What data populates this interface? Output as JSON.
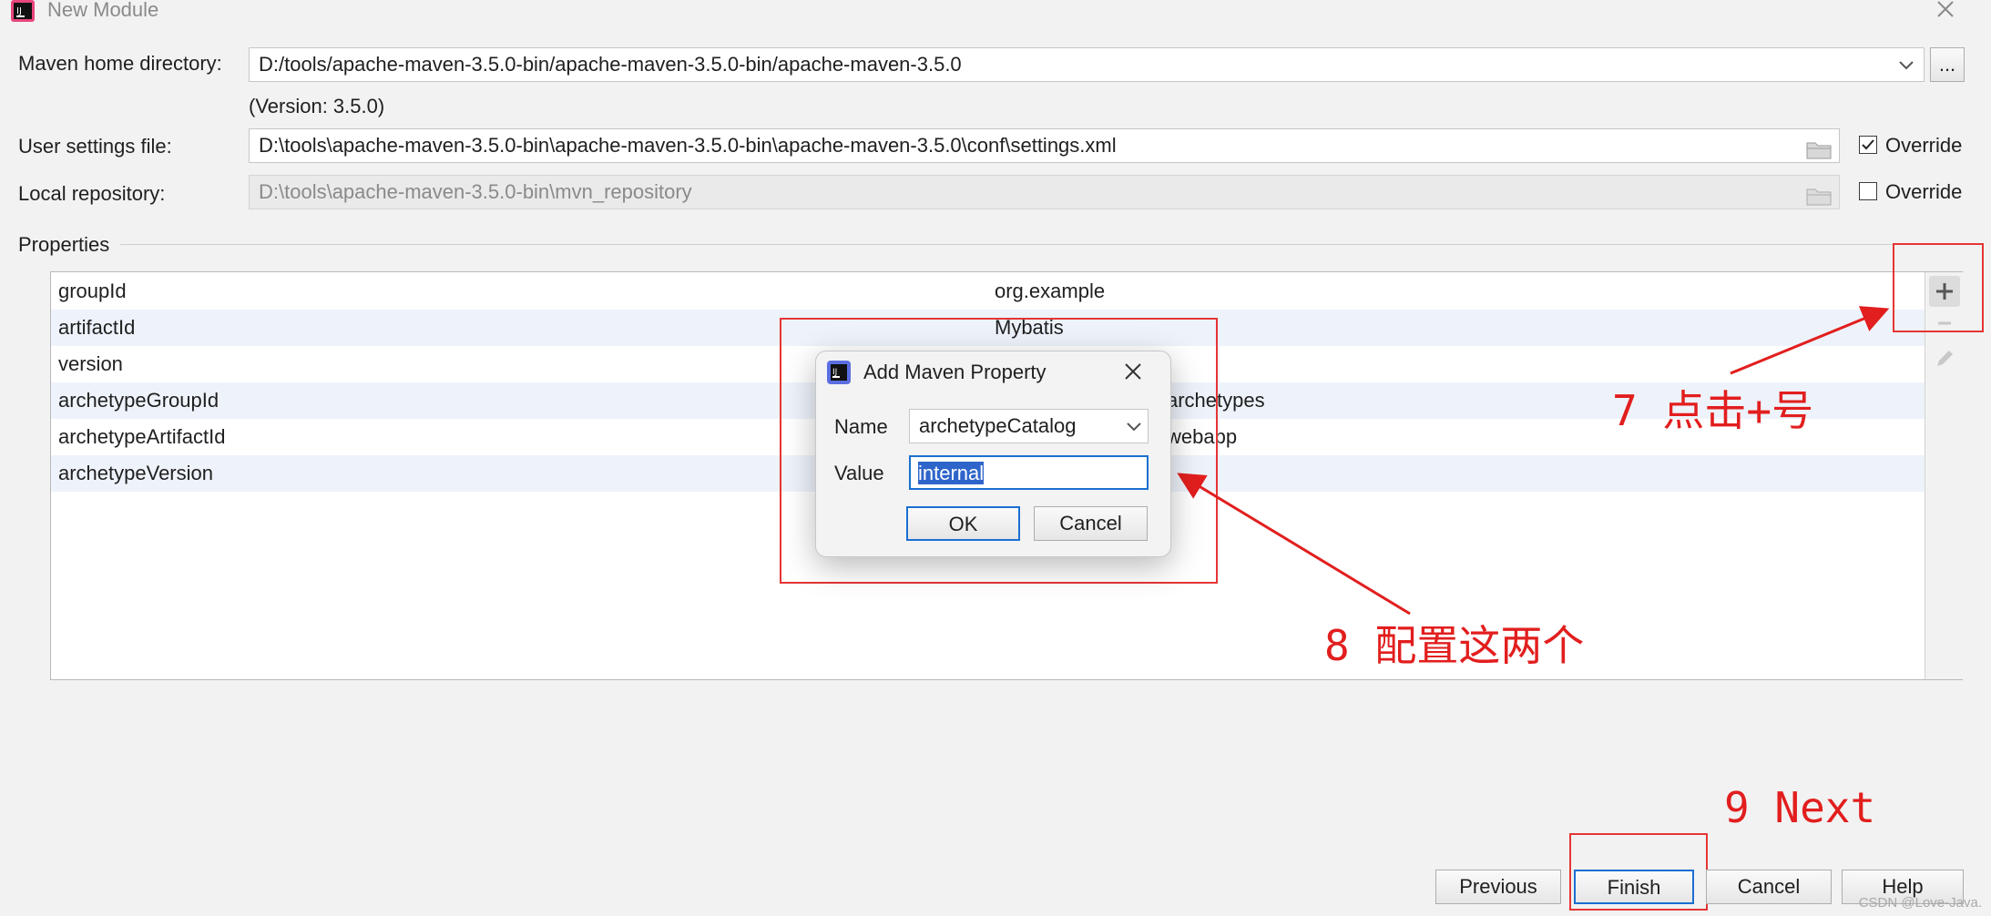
{
  "window": {
    "title": "New Module"
  },
  "form": {
    "maven_home_label": "Maven home directory:",
    "maven_home_value": "D:/tools/apache-maven-3.5.0-bin/apache-maven-3.5.0-bin/apache-maven-3.5.0",
    "browse_label": "...",
    "version_text": "(Version: 3.5.0)",
    "user_settings_label": "User settings file:",
    "user_settings_value": "D:\\tools\\apache-maven-3.5.0-bin\\apache-maven-3.5.0-bin\\apache-maven-3.5.0\\conf\\settings.xml",
    "local_repo_label": "Local repository:",
    "local_repo_value": "D:\\tools\\apache-maven-3.5.0-bin\\mvn_repository",
    "override_label": "Override",
    "override_settings_checked": true,
    "override_repo_checked": false
  },
  "properties": {
    "section_label": "Properties",
    "rows": [
      {
        "key": "groupId",
        "value": "org.example"
      },
      {
        "key": "artifactId",
        "value": "Mybatis"
      },
      {
        "key": "version",
        "value": ""
      },
      {
        "key": "archetypeGroupId",
        "value": "archetypes"
      },
      {
        "key": "archetypeArtifactId",
        "value": "webapp"
      },
      {
        "key": "archetypeVersion",
        "value": ""
      }
    ]
  },
  "dialog": {
    "title": "Add Maven Property",
    "name_label": "Name",
    "name_value": "archetypeCatalog",
    "value_label": "Value",
    "value_value": "internal",
    "ok_label": "OK",
    "cancel_label": "Cancel"
  },
  "footer": {
    "previous_label": "Previous",
    "finish_label": "Finish",
    "cancel_label": "Cancel",
    "help_label": "Help"
  },
  "annotations": {
    "step7": "7 点击+号",
    "step8": "8 配置这两个",
    "step9": "9 Next"
  },
  "watermark": "CSDN @Love-Java.",
  "colors": {
    "annotation_red": "#e21e1e",
    "selection_blue": "#2f65ca",
    "focus_blue": "#1a6fd0"
  }
}
